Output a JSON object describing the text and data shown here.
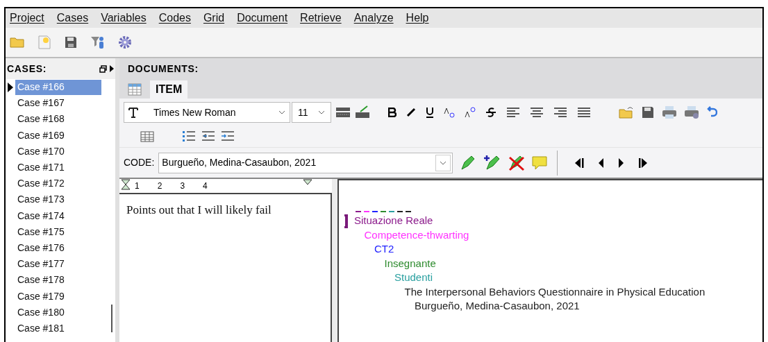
{
  "menu": [
    "Project",
    "Cases",
    "Variables",
    "Codes",
    "Grid",
    "Document",
    "Retrieve",
    "Analyze",
    "Help"
  ],
  "cases": {
    "title": "CASES:",
    "items": [
      {
        "label": "Case #166",
        "selected": true
      },
      {
        "label": "Case #167",
        "selected": false
      },
      {
        "label": "Case #168",
        "selected": false
      },
      {
        "label": "Case #169",
        "selected": false
      },
      {
        "label": "Case #170",
        "selected": false
      },
      {
        "label": "Case #171",
        "selected": false
      },
      {
        "label": "Case #172",
        "selected": false
      },
      {
        "label": "Case #173",
        "selected": false
      },
      {
        "label": "Case #174",
        "selected": false
      },
      {
        "label": "Case #175",
        "selected": false
      },
      {
        "label": "Case #176",
        "selected": false
      },
      {
        "label": "Case #177",
        "selected": false
      },
      {
        "label": "Case #178",
        "selected": false
      },
      {
        "label": "Case #179",
        "selected": false
      },
      {
        "label": "Case #180",
        "selected": false
      },
      {
        "label": "Case #181",
        "selected": false
      }
    ]
  },
  "documents": {
    "title": "DOCUMENTS:",
    "tab": "ITEM",
    "font_family": "Times New Roman",
    "font_size": "11",
    "code_label": "CODE:",
    "code_value": "Burgueño, Medina-Casaubon, 2021",
    "ruler": [
      "1",
      "2",
      "3",
      "4"
    ],
    "memo": "Points out that I will likely fail",
    "codes": [
      {
        "label": "Situazione Reale",
        "color": "#8b1a8b",
        "children": [
          {
            "label": "Competence-thwarting",
            "color": "#ff33ff",
            "children": [
              {
                "label": "CT2",
                "color": "#2222ff",
                "children": [
                  {
                    "label": "Insegnante",
                    "color": "#2e8b2e",
                    "children": [
                      {
                        "label": "Studenti",
                        "color": "#2aa0a0",
                        "children": [
                          {
                            "label": "The Interpersonal Behaviors Questionnaire in Physical Education",
                            "color": "#222222",
                            "children": [
                              {
                                "label": "Burgueño, Medina-Casaubon, 2021",
                                "color": "#222222"
                              }
                            ]
                          }
                        ]
                      }
                    ]
                  }
                ]
              }
            ]
          }
        ]
      }
    ]
  }
}
